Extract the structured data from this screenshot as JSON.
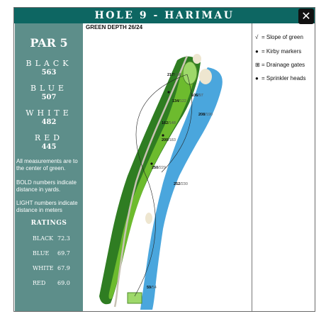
{
  "header": {
    "title": "HOLE 9 - HARIMAU",
    "close_icon": "close-icon"
  },
  "sidebar": {
    "par": "PAR 5",
    "tees": [
      {
        "name": "BLACK",
        "yards": "563"
      },
      {
        "name": "BLUE",
        "yards": "507"
      },
      {
        "name": "WHITE",
        "yards": "482"
      },
      {
        "name": "RED",
        "yards": "445"
      }
    ],
    "notes": [
      "All measurements are to the center of green.",
      "BOLD numbers indicate distance in yards.",
      "LIGHT numbers indicate distance in meters"
    ],
    "ratings_title": "RATINGS",
    "ratings": [
      {
        "name": "BLACK",
        "value": "72.3"
      },
      {
        "name": "BLUE",
        "value": "69.7"
      },
      {
        "name": "WHITE",
        "value": "67.9"
      },
      {
        "name": "RED",
        "value": "69.0"
      }
    ]
  },
  "map": {
    "green_depth": "GREEN DEPTH 26/24",
    "distances": [
      {
        "yards": "217",
        "meters": "198"
      },
      {
        "yards": "106",
        "meters": "97"
      },
      {
        "yards": "134",
        "meters": "122"
      },
      {
        "yards": "208",
        "meters": "190"
      },
      {
        "yards": "162",
        "meters": "148"
      },
      {
        "yards": "200",
        "meters": "183"
      },
      {
        "yards": "250",
        "meters": "229"
      },
      {
        "yards": "252",
        "meters": "230"
      },
      {
        "yards": "59",
        "meters": "54"
      }
    ]
  },
  "legend": [
    {
      "icon": "slope-check-icon",
      "glyph": "√",
      "label": "= Slope of green"
    },
    {
      "icon": "kirby-marker-icon",
      "glyph": "●",
      "label": "= Kirby markers"
    },
    {
      "icon": "drainage-gate-icon",
      "glyph": "⊞",
      "label": "= Drainage gates"
    },
    {
      "icon": "sprinkler-head-icon",
      "glyph": "●",
      "label": "= Sprinkler heads"
    }
  ],
  "colors": {
    "header": "#0d6662",
    "sidebar": "#5d8e8a",
    "water": "#4aa6dd",
    "fairway": "#6dbb2e",
    "rough": "#2f7d22"
  }
}
